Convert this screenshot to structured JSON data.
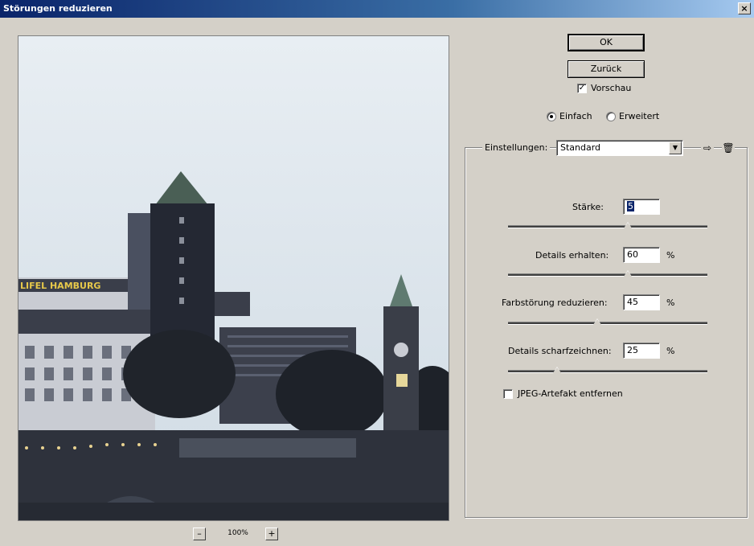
{
  "window": {
    "title": "Störungen reduzieren",
    "close_glyph": "×"
  },
  "buttons": {
    "ok": "OK",
    "back": "Zurück"
  },
  "preview_checkbox": {
    "label": "Vorschau",
    "checked": true
  },
  "mode": {
    "options": [
      {
        "label": "Einfach",
        "selected": true
      },
      {
        "label": "Erweitert",
        "selected": false
      }
    ]
  },
  "settings": {
    "label": "Einstellungen:",
    "selected": "Standard",
    "icons": [
      "save-settings-icon",
      "delete-settings-icon"
    ]
  },
  "controls": [
    {
      "label": "Stärke:",
      "value": "5",
      "unit": "",
      "slider_fraction": 0.5,
      "focused": true
    },
    {
      "label": "Details erhalten:",
      "value": "60",
      "unit": "%",
      "slider_fraction": 0.6
    },
    {
      "label": "Farbstörung reduzieren:",
      "value": "45",
      "unit": "%",
      "slider_fraction": 0.45
    },
    {
      "label": "Details scharfzeichnen:",
      "value": "25",
      "unit": "%",
      "slider_fraction": 0.25
    }
  ],
  "jpeg_checkbox": {
    "label": "JPEG-Artefakt entfernen",
    "checked": false
  },
  "zoom": {
    "minus": "–",
    "level": "100%",
    "plus": "+"
  },
  "preview_image": {
    "sign_text": "LIFEL HAMBURG",
    "sky_color": "#dde6ee",
    "building_color": "#2b2f3a"
  }
}
